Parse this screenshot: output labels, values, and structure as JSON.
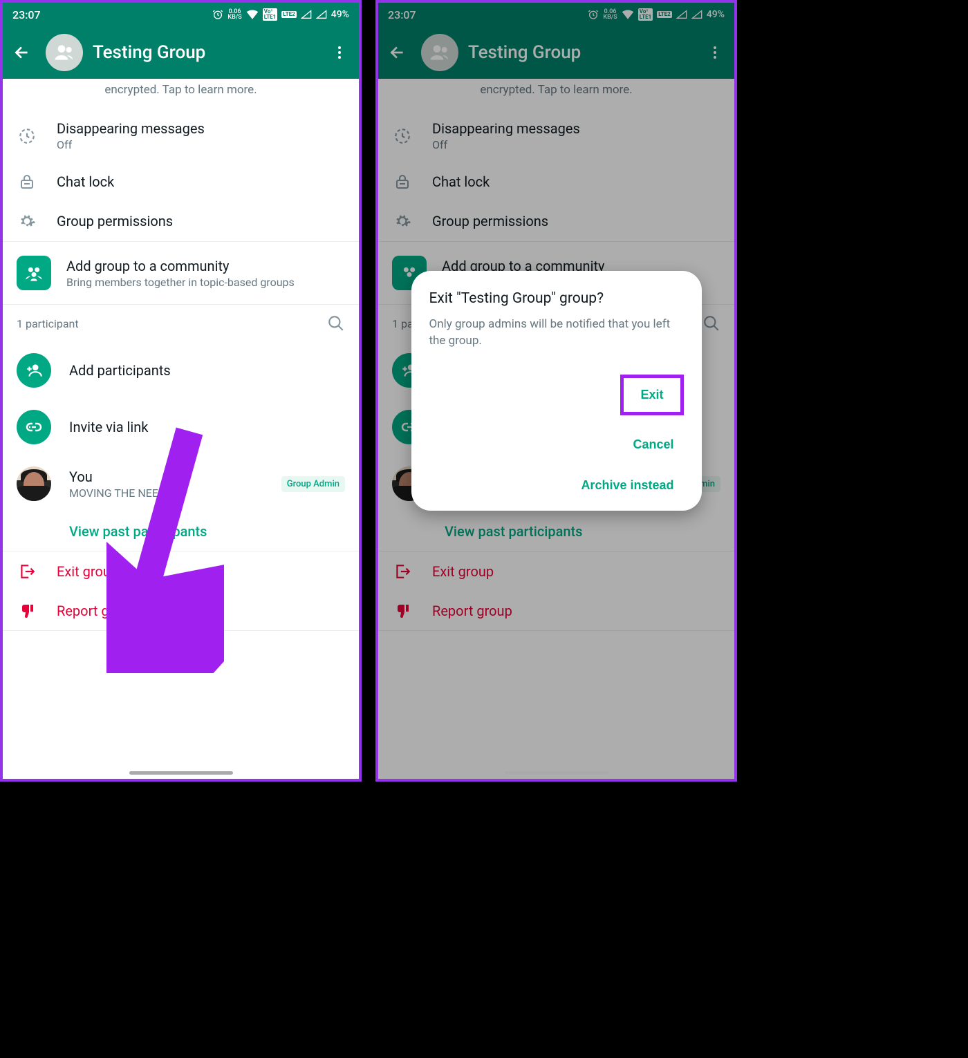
{
  "status": {
    "time": "23:07",
    "kbps_top": "0.06",
    "kbps_bot": "KB/S",
    "lte1": "Vo 1\nLTE 1",
    "lte2": "LTE 2",
    "battery": "49%"
  },
  "appbar": {
    "title": "Testing Group"
  },
  "truncated_line": "encrypted. Tap to learn more.",
  "settings": {
    "disappearing": {
      "title": "Disappearing messages",
      "sub": "Off"
    },
    "chatlock": {
      "title": "Chat lock"
    },
    "permissions": {
      "title": "Group permissions"
    }
  },
  "community": {
    "title": "Add group to a community",
    "sub": "Bring members together in topic-based groups"
  },
  "participants_header": "1 participant",
  "add_participants": "Add participants",
  "invite_link": "Invite via link",
  "member": {
    "name": "You",
    "status": "MOVING THE NEEDLE",
    "badge": "Group Admin"
  },
  "view_past": "View past participants",
  "exit_group": "Exit group",
  "report_group": "Report group",
  "dialog": {
    "title": "Exit \"Testing Group\" group?",
    "body": "Only group admins will be notified that you left the group.",
    "exit": "Exit",
    "cancel": "Cancel",
    "archive": "Archive instead"
  }
}
